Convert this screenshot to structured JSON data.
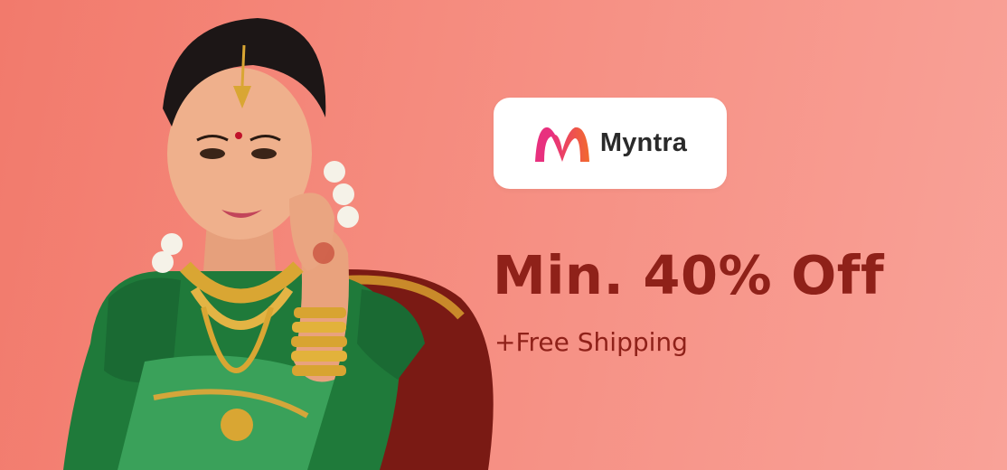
{
  "brand": {
    "name": "Myntra"
  },
  "offer": {
    "headline": "Min. 40% Off",
    "subline": "+Free Shipping"
  },
  "colors": {
    "background_start": "#f27a6c",
    "background_end": "#f9a298",
    "headline_text": "#8f2119",
    "logo_card": "#ffffff",
    "logo_pink": "#e8307e",
    "logo_orange": "#f26a2d"
  }
}
